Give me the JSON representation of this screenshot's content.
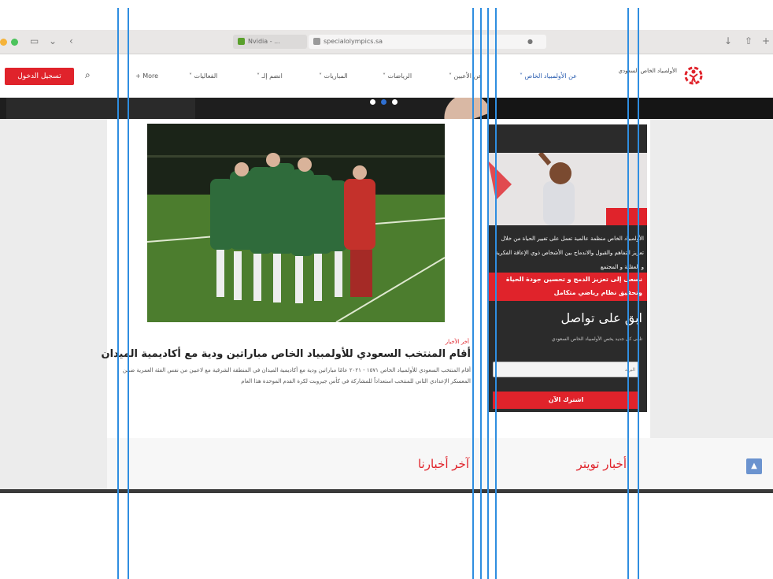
{
  "browser": {
    "tabs": [
      {
        "label": "Nvidia - ..."
      },
      {
        "label": "specialolympics.sa"
      }
    ]
  },
  "header": {
    "logo_text": "الأولمبياد الخاص السعودي",
    "login_button": "تسجيل الدخول",
    "nav": [
      {
        "label": "عن الأولمبياد الخاص ˅"
      },
      {
        "label": "عن الأعبين ˅"
      },
      {
        "label": "الرياضات ˅"
      },
      {
        "label": "المباريات ˅"
      },
      {
        "label": "انضم إلـ ˅"
      },
      {
        "label": "الفعاليات ˅"
      },
      {
        "label": "More +"
      }
    ]
  },
  "article": {
    "category": "أخر الأخبار",
    "title": "أقام المنتخب السعودي للأولمبياد الخاص مباراتين ودية مع أكاديمية الميدان",
    "body": "أقام المنتخب السعودي للأولمبياد الخاص ١٥٧١ - ٢٠٢١ عامًا مباراتين ودية مع أكاديمية الميدان في المنطقة الشرقية مع لاعبين من نفس الفئة العمرية ضمن المعسكر الإعدادي الثاني للمنتخب استعداداً للمشاركة في كأس جيروبت لكرة القدم الموحدة هذا العام"
  },
  "sidebar": {
    "intro": "الأولمبياد الخاص منظمة عالمية تعمل على تغيير الحياة من خلال تعزيز التفاهم والقبول والاندماج بين الأشخاص ذوي الإعاقة الفكرية و العقلية و المجتمع",
    "banner": "نسعى إلى تعزيز الدمج و تحسين جودة الحياة وتحقيق نظام رياضي متكامل",
    "subscribe_title": "ابق على تواصل",
    "subscribe_text": "تلقى كل جديد يخص الأولمبياد الخاص السعودي",
    "email_placeholder": "البريد",
    "subscribe_button": "اشترك الآن"
  },
  "sections": {
    "latest_news": "آخر أخبارنا",
    "twitter_news": "أخبار تويتر"
  }
}
